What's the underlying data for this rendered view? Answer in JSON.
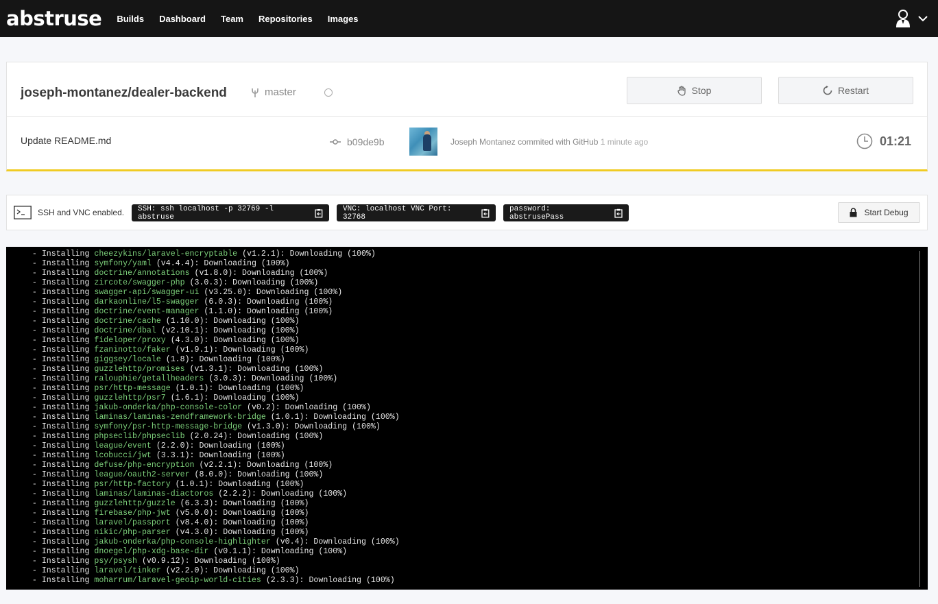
{
  "app": {
    "logo": "abstruse",
    "nav": [
      "Builds",
      "Dashboard",
      "Team",
      "Repositories",
      "Images"
    ]
  },
  "build": {
    "repo": "joseph-montanez/dealer-backend",
    "branch": "master",
    "stop_label": "Stop",
    "restart_label": "Restart",
    "commit_message": "Update README.md",
    "commit_sha": "b09de9b",
    "committer": "Joseph Montanez commited with GitHub",
    "time_ago": "1 minute ago",
    "duration": "01:21"
  },
  "debug": {
    "status": "SSH and VNC enabled.",
    "ssh": "SSH: ssh localhost -p 32769 -l abstruse",
    "vnc": "VNC: localhost VNC Port: 32768",
    "password": "password: abstrusePass",
    "start_label": "Start Debug"
  },
  "colors": {
    "topbar": "#151515",
    "accent": "#f0cb23",
    "terminal_bg": "#000000",
    "package_green": "#7ccf7a"
  },
  "log": [
    {
      "prefix": "  - Installing ",
      "pkg": "cheezykins/laravel-encryptable",
      "suffix": " (v1.2.1): Downloading (100%)"
    },
    {
      "prefix": "  - Installing ",
      "pkg": "symfony/yaml",
      "suffix": " (v4.4.4): Downloading (100%)"
    },
    {
      "prefix": "  - Installing ",
      "pkg": "doctrine/annotations",
      "suffix": " (v1.8.0): Downloading (100%)"
    },
    {
      "prefix": "  - Installing ",
      "pkg": "zircote/swagger-php",
      "suffix": " (3.0.3): Downloading (100%)"
    },
    {
      "prefix": "  - Installing ",
      "pkg": "swagger-api/swagger-ui",
      "suffix": " (v3.25.0): Downloading (100%)"
    },
    {
      "prefix": "  - Installing ",
      "pkg": "darkaonline/l5-swagger",
      "suffix": " (6.0.3): Downloading (100%)"
    },
    {
      "prefix": "  - Installing ",
      "pkg": "doctrine/event-manager",
      "suffix": " (1.1.0): Downloading (100%)"
    },
    {
      "prefix": "  - Installing ",
      "pkg": "doctrine/cache",
      "suffix": " (1.10.0): Downloading (100%)"
    },
    {
      "prefix": "  - Installing ",
      "pkg": "doctrine/dbal",
      "suffix": " (v2.10.1): Downloading (100%)"
    },
    {
      "prefix": "  - Installing ",
      "pkg": "fideloper/proxy",
      "suffix": " (4.3.0): Downloading (100%)"
    },
    {
      "prefix": "  - Installing ",
      "pkg": "fzaninotto/faker",
      "suffix": " (v1.9.1): Downloading (100%)"
    },
    {
      "prefix": "  - Installing ",
      "pkg": "giggsey/locale",
      "suffix": " (1.8): Downloading (100%)"
    },
    {
      "prefix": "  - Installing ",
      "pkg": "guzzlehttp/promises",
      "suffix": " (v1.3.1): Downloading (100%)"
    },
    {
      "prefix": "  - Installing ",
      "pkg": "ralouphie/getallheaders",
      "suffix": " (3.0.3): Downloading (100%)"
    },
    {
      "prefix": "  - Installing ",
      "pkg": "psr/http-message",
      "suffix": " (1.0.1): Downloading (100%)"
    },
    {
      "prefix": "  - Installing ",
      "pkg": "guzzlehttp/psr7",
      "suffix": " (1.6.1): Downloading (100%)"
    },
    {
      "prefix": "  - Installing ",
      "pkg": "jakub-onderka/php-console-color",
      "suffix": " (v0.2): Downloading (100%)"
    },
    {
      "prefix": "  - Installing ",
      "pkg": "laminas/laminas-zendframework-bridge",
      "suffix": " (1.0.1): Downloading (100%)"
    },
    {
      "prefix": "  - Installing ",
      "pkg": "symfony/psr-http-message-bridge",
      "suffix": " (v1.3.0): Downloading (100%)"
    },
    {
      "prefix": "  - Installing ",
      "pkg": "phpseclib/phpseclib",
      "suffix": " (2.0.24): Downloading (100%)"
    },
    {
      "prefix": "  - Installing ",
      "pkg": "league/event",
      "suffix": " (2.2.0): Downloading (100%)"
    },
    {
      "prefix": "  - Installing ",
      "pkg": "lcobucci/jwt",
      "suffix": " (3.3.1): Downloading (100%)"
    },
    {
      "prefix": "  - Installing ",
      "pkg": "defuse/php-encryption",
      "suffix": " (v2.2.1): Downloading (100%)"
    },
    {
      "prefix": "  - Installing ",
      "pkg": "league/oauth2-server",
      "suffix": " (8.0.0): Downloading (100%)"
    },
    {
      "prefix": "  - Installing ",
      "pkg": "psr/http-factory",
      "suffix": " (1.0.1): Downloading (100%)"
    },
    {
      "prefix": "  - Installing ",
      "pkg": "laminas/laminas-diactoros",
      "suffix": " (2.2.2): Downloading (100%)"
    },
    {
      "prefix": "  - Installing ",
      "pkg": "guzzlehttp/guzzle",
      "suffix": " (6.3.3): Downloading (100%)"
    },
    {
      "prefix": "  - Installing ",
      "pkg": "firebase/php-jwt",
      "suffix": " (v5.0.0): Downloading (100%)"
    },
    {
      "prefix": "  - Installing ",
      "pkg": "laravel/passport",
      "suffix": " (v8.4.0): Downloading (100%)"
    },
    {
      "prefix": "  - Installing ",
      "pkg": "nikic/php-parser",
      "suffix": " (v4.3.0): Downloading (100%)"
    },
    {
      "prefix": "  - Installing ",
      "pkg": "jakub-onderka/php-console-highlighter",
      "suffix": " (v0.4): Downloading (100%)"
    },
    {
      "prefix": "  - Installing ",
      "pkg": "dnoegel/php-xdg-base-dir",
      "suffix": " (v0.1.1): Downloading (100%)"
    },
    {
      "prefix": "  - Installing ",
      "pkg": "psy/psysh",
      "suffix": " (v0.9.12): Downloading (100%)"
    },
    {
      "prefix": "  - Installing ",
      "pkg": "laravel/tinker",
      "suffix": " (v2.2.0): Downloading (100%)"
    },
    {
      "prefix": "  - Installing ",
      "pkg": "moharrum/laravel-geoip-world-cities",
      "suffix": " (2.3.3): Downloading (100%)"
    }
  ]
}
